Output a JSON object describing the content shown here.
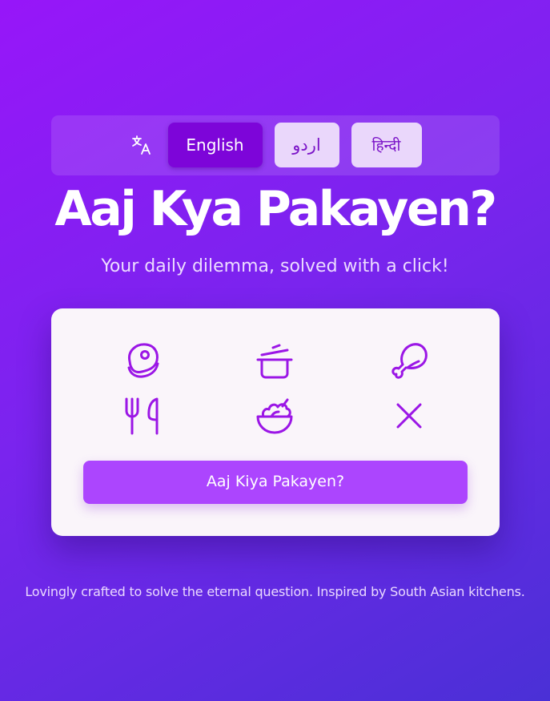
{
  "language_bar": {
    "icon": "translate-icon",
    "languages": [
      {
        "label": "English",
        "active": true
      },
      {
        "label": "اردو",
        "active": false
      },
      {
        "label": "हिन्दी",
        "active": false
      }
    ]
  },
  "hero": {
    "title": "Aaj Kya Pakayen?",
    "subtitle": "Your daily dilemma, solved with a click!"
  },
  "card": {
    "icons": [
      "meat-icon",
      "cooking-pot-icon",
      "chicken-leg-icon",
      "fork-knife-icon",
      "salad-bowl-icon",
      "close-icon"
    ],
    "button_label": "Aaj Kiya Pakayen?"
  },
  "footer": {
    "text": "Lovingly crafted to solve the eternal question. Inspired by South Asian kitchens."
  },
  "colors": {
    "background_start": "#9716f9",
    "background_end": "#4a30d6",
    "accent": "#ac45fe",
    "active_language": "#7d05d9",
    "inactive_language": "#ead7fb",
    "icon_stroke": "#9b16e6",
    "card": "#faf5fa"
  }
}
